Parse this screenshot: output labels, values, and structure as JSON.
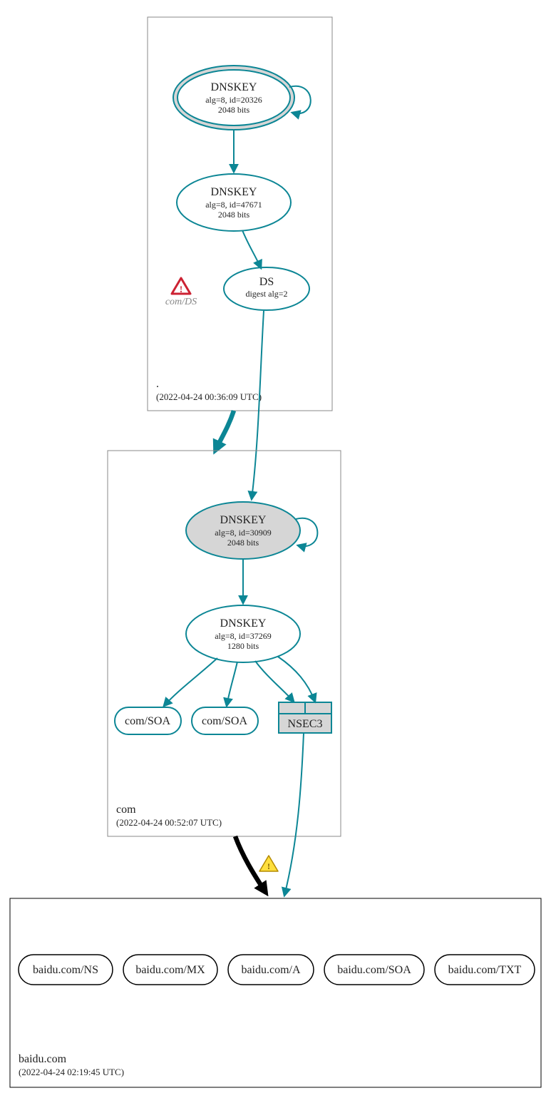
{
  "zones": {
    "root": {
      "label": ".",
      "timestamp": "(2022-04-24 00:36:09 UTC)"
    },
    "com": {
      "label": "com",
      "timestamp": "(2022-04-24 00:52:07 UTC)"
    },
    "baidu": {
      "label": "baidu.com",
      "timestamp": "(2022-04-24 02:19:45 UTC)"
    }
  },
  "nodes": {
    "rootKSK": {
      "title": "DNSKEY",
      "line2": "alg=8, id=20326",
      "line3": "2048 bits"
    },
    "rootZSK": {
      "title": "DNSKEY",
      "line2": "alg=8, id=47671",
      "line3": "2048 bits"
    },
    "rootDS": {
      "title": "DS",
      "line2": "digest alg=2"
    },
    "comKSK": {
      "title": "DNSKEY",
      "line2": "alg=8, id=30909",
      "line3": "2048 bits"
    },
    "comZSK": {
      "title": "DNSKEY",
      "line2": "alg=8, id=37269",
      "line3": "1280 bits"
    },
    "comSOA1": {
      "title": "com/SOA"
    },
    "comSOA2": {
      "title": "com/SOA"
    },
    "nsec3": {
      "title": "NSEC3"
    },
    "errDS": {
      "label": "com/DS"
    },
    "baiduNS": {
      "title": "baidu.com/NS"
    },
    "baiduMX": {
      "title": "baidu.com/MX"
    },
    "baiduA": {
      "title": "baidu.com/A"
    },
    "baiduSOA": {
      "title": "baidu.com/SOA"
    },
    "baiduTXT": {
      "title": "baidu.com/TXT"
    }
  }
}
